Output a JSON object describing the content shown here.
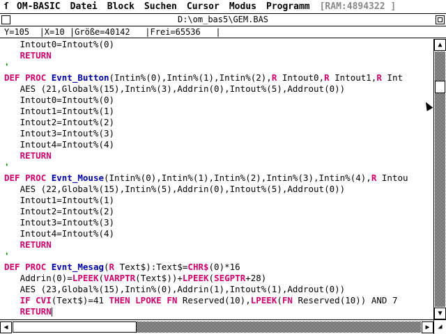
{
  "menubar": {
    "apple_icon": "ſ",
    "items": [
      "OM-BASIC",
      "Datei",
      "Block",
      "Suchen",
      "Cursor",
      "Modus",
      "Programm"
    ],
    "ram": "[RAM:4894322 ]"
  },
  "window": {
    "title": "D:\\om_bas5\\GEM.BAS",
    "status": "Y=105  |X=10 |Größe=40142   |Frei=65536   |"
  },
  "editor": {
    "lines": [
      [
        {
          "c": "tx",
          "t": "   Intout0=Intout%(0)"
        }
      ],
      [
        {
          "c": "tx",
          "t": "   "
        },
        {
          "c": "kw",
          "t": "RETURN"
        }
      ],
      [
        {
          "c": "cm",
          "t": "'"
        }
      ],
      [
        {
          "c": "kw",
          "t": "DEF PROC "
        },
        {
          "c": "nm",
          "t": "Evnt_Button"
        },
        {
          "c": "tx",
          "t": "(Intin%(0),Intin%(1),Intin%(2),"
        },
        {
          "c": "kw",
          "t": "R"
        },
        {
          "c": "tx",
          "t": " Intout0,"
        },
        {
          "c": "kw",
          "t": "R"
        },
        {
          "c": "tx",
          "t": " Intout1,"
        },
        {
          "c": "kw",
          "t": "R"
        },
        {
          "c": "tx",
          "t": " Int"
        }
      ],
      [
        {
          "c": "tx",
          "t": "   AES (21,Global%(15),Intin%(3),Addrin(0),Intout%(5),Addrout(0))"
        }
      ],
      [
        {
          "c": "tx",
          "t": "   Intout0=Intout%(0)"
        }
      ],
      [
        {
          "c": "tx",
          "t": "   Intout1=Intout%(1)"
        }
      ],
      [
        {
          "c": "tx",
          "t": "   Intout2=Intout%(2)"
        }
      ],
      [
        {
          "c": "tx",
          "t": "   Intout3=Intout%(3)"
        }
      ],
      [
        {
          "c": "tx",
          "t": "   Intout4=Intout%(4)"
        }
      ],
      [
        {
          "c": "tx",
          "t": "   "
        },
        {
          "c": "kw",
          "t": "RETURN"
        }
      ],
      [
        {
          "c": "cm",
          "t": "'"
        }
      ],
      [
        {
          "c": "kw",
          "t": "DEF PROC "
        },
        {
          "c": "nm",
          "t": "Evnt_Mouse"
        },
        {
          "c": "tx",
          "t": "(Intin%(0),Intin%(1),Intin%(2),Intin%(3),Intin%(4),"
        },
        {
          "c": "kw",
          "t": "R"
        },
        {
          "c": "tx",
          "t": " Intou"
        }
      ],
      [
        {
          "c": "tx",
          "t": "   AES (22,Global%(15),Intin%(5),Addrin(0),Intout%(5),Addrout(0))"
        }
      ],
      [
        {
          "c": "tx",
          "t": "   Intout1=Intout%(1)"
        }
      ],
      [
        {
          "c": "tx",
          "t": "   Intout2=Intout%(2)"
        }
      ],
      [
        {
          "c": "tx",
          "t": "   Intout3=Intout%(3)"
        }
      ],
      [
        {
          "c": "tx",
          "t": "   Intout4=Intout%(4)"
        }
      ],
      [
        {
          "c": "tx",
          "t": "   "
        },
        {
          "c": "kw",
          "t": "RETURN"
        }
      ],
      [
        {
          "c": "cm",
          "t": "'"
        }
      ],
      [
        {
          "c": "kw",
          "t": "DEF PROC "
        },
        {
          "c": "nm",
          "t": "Evnt_Mesag"
        },
        {
          "c": "tx",
          "t": "("
        },
        {
          "c": "kw",
          "t": "R"
        },
        {
          "c": "tx",
          "t": " Text$):Text$="
        },
        {
          "c": "kw",
          "t": "CHR$"
        },
        {
          "c": "tx",
          "t": "(0)*16"
        }
      ],
      [
        {
          "c": "tx",
          "t": "   Addrin(0)="
        },
        {
          "c": "kw",
          "t": "LPEEK"
        },
        {
          "c": "tx",
          "t": "("
        },
        {
          "c": "kw",
          "t": "VARPTR"
        },
        {
          "c": "tx",
          "t": "(Text$))+"
        },
        {
          "c": "kw",
          "t": "LPEEK"
        },
        {
          "c": "tx",
          "t": "("
        },
        {
          "c": "kw",
          "t": "SEGPTR"
        },
        {
          "c": "tx",
          "t": "+28)"
        }
      ],
      [
        {
          "c": "tx",
          "t": "   AES (23,Global%(15),Intin%(0),Addrin(1),Intout%(1),Addrout(0))"
        }
      ],
      [
        {
          "c": "tx",
          "t": "   "
        },
        {
          "c": "kw",
          "t": "IF CVI"
        },
        {
          "c": "tx",
          "t": "(Text$)=41 "
        },
        {
          "c": "kw",
          "t": "THEN LPOKE FN"
        },
        {
          "c": "tx",
          "t": " Reserved(10),"
        },
        {
          "c": "kw",
          "t": "LPEEK"
        },
        {
          "c": "tx",
          "t": "("
        },
        {
          "c": "kw",
          "t": "FN"
        },
        {
          "c": "tx",
          "t": " Reserved(10)) AND 7"
        }
      ],
      [
        {
          "c": "tx",
          "t": "   "
        },
        {
          "c": "kw",
          "t": "RETURN"
        }
      ]
    ]
  },
  "icons": {
    "close": "close-icon",
    "fuller": "fuller-icon",
    "up": "▲",
    "down": "▼",
    "left": "◀",
    "right": "▶",
    "size": "◢"
  },
  "scroll": {
    "vertical_position": 0.12,
    "horizontal_position": 0.0
  }
}
